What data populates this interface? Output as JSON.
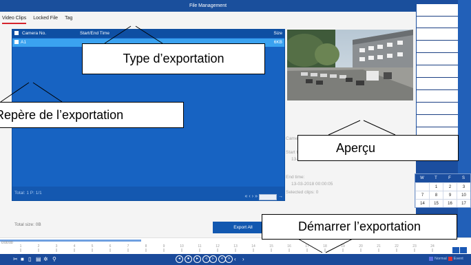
{
  "window_title": "File Management",
  "tabs": [
    {
      "label": "Video Clips",
      "active": true
    },
    {
      "label": "Locked File",
      "active": false
    },
    {
      "label": "Tag",
      "active": false
    }
  ],
  "file_table": {
    "columns": [
      "Camera No.",
      "Start/End Time",
      "Size"
    ],
    "rows": [
      {
        "camera": "A1",
        "time": "",
        "size": "6KB"
      }
    ],
    "footer_total": "Total: 1  P: 1/1"
  },
  "clip_info": {
    "camera_label": "Camera with clip",
    "start_label": "Start time:",
    "start_value": "13-03-2018 0",
    "end_label": "End time:",
    "end_value": "13-03-2018 00:00:05",
    "selected": "Selected clips: 0"
  },
  "total_size": "Total size: 0B",
  "export_all_label": "Export All",
  "timeline": {
    "start_label": "0:00:00",
    "ticks": [
      "1",
      "2",
      "3",
      "4",
      "5",
      "6",
      "7",
      "8",
      "9",
      "10",
      "11",
      "12",
      "13",
      "14",
      "15",
      "16",
      "17",
      "18",
      "19",
      "20",
      "21",
      "22",
      "23",
      "24"
    ]
  },
  "calendar": {
    "days": [
      "W",
      "T",
      "F",
      "S"
    ],
    "rows": [
      [
        "",
        "1",
        "2",
        "3"
      ],
      [
        "7",
        "8",
        "9",
        "10"
      ],
      [
        "14",
        "15",
        "16",
        "17"
      ]
    ]
  },
  "legend": [
    {
      "label": "Normal",
      "color": "#5b6ee0"
    },
    {
      "label": "Event",
      "color": "#e03030"
    }
  ],
  "callouts": {
    "export_type": "Type d’exportation",
    "export_mark": "Repère de l’exportation",
    "preview": "Aperçu",
    "start_export": "Démarrer l’exportation"
  },
  "colors": {
    "title_bar": "#1a4f9c",
    "list_bg": "#1763c2",
    "selected_row": "#3aa2f0",
    "export_button": "#1258b0"
  }
}
